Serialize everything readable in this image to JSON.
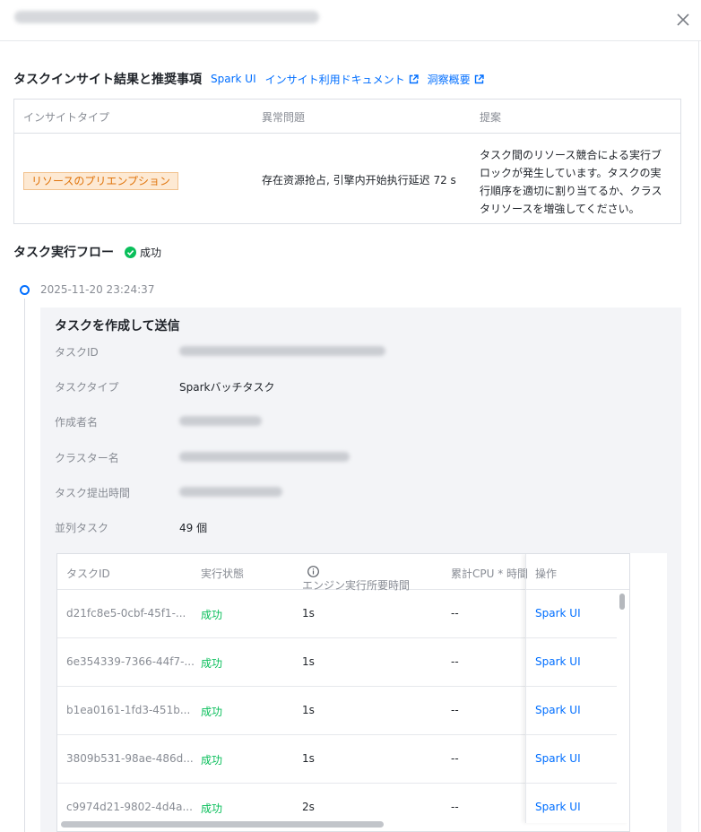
{
  "header": {
    "close_label": "×"
  },
  "insight": {
    "title": "タスクインサイト結果と推奨事項",
    "links": [
      "Spark UI",
      "インサイト利用ドキュメント",
      "洞察概要"
    ],
    "columns": [
      "インサイトタイプ",
      "異常問題",
      "提案"
    ],
    "row": {
      "type": "リソースのプリエンプション",
      "problem": "存在资源抢占, 引擎内开始执行延迟 72 s",
      "suggestion": "タスク間のリソース競合による実行ブロックが発生しています。タスクの実行順序を適切に割り当てるか、クラスタリソースを増強してください。"
    }
  },
  "flow": {
    "title": "タスク実行フロー",
    "status": "成功",
    "timestamp": "2025-11-20 23:24:37"
  },
  "panel": {
    "title": "タスクを作成して送信",
    "fields": [
      {
        "label": "タスクID"
      },
      {
        "label": "タスクタイプ",
        "value": "Sparkバッチタスク"
      },
      {
        "label": "作成者名"
      },
      {
        "label": "クラスター名"
      },
      {
        "label": "タスク提出時間"
      },
      {
        "label": "並列タスク",
        "value": "49 個"
      }
    ]
  },
  "subtasks": {
    "columns": [
      "タスクID",
      "実行状態",
      "エンジン実行所要時間",
      "累計CPU * 時間",
      "操作"
    ],
    "rows": [
      {
        "id": "d21fc8e5-0cbf-45f1-...",
        "status": "成功",
        "time": "1s",
        "cpu": "--",
        "op": "Spark UI"
      },
      {
        "id": "6e354339-7366-44f7-...",
        "status": "成功",
        "time": "1s",
        "cpu": "--",
        "op": "Spark UI"
      },
      {
        "id": "b1ea0161-1fd3-451b...",
        "status": "成功",
        "time": "1s",
        "cpu": "--",
        "op": "Spark UI"
      },
      {
        "id": "3809b531-98ae-486d...",
        "status": "成功",
        "time": "1s",
        "cpu": "--",
        "op": "Spark UI"
      },
      {
        "id": "c9974d21-9802-4d4a...",
        "status": "成功",
        "time": "2s",
        "cpu": "--",
        "op": "Spark UI"
      }
    ]
  },
  "colors": {
    "accent": "#006eff",
    "success": "#0abf5b",
    "warning_text": "#e0740b",
    "warning_bg": "#fde9d3"
  }
}
